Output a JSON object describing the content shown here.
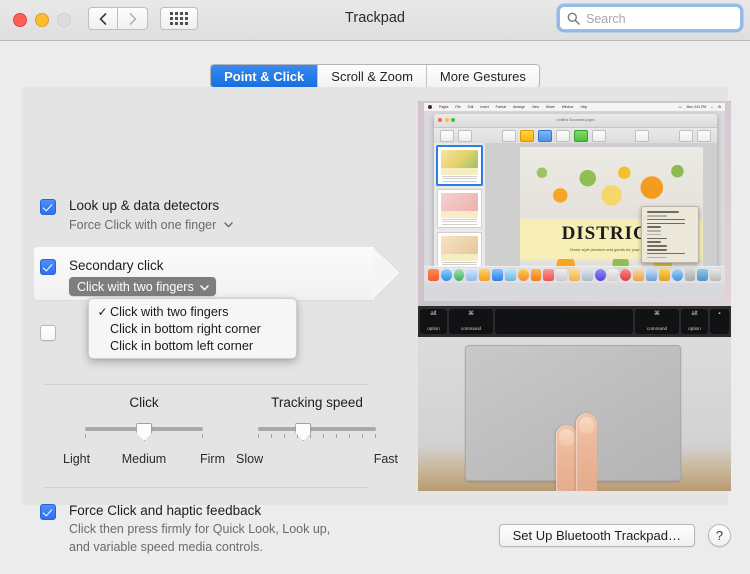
{
  "window": {
    "title": "Trackpad",
    "traffic_lights": [
      "close",
      "minimize",
      "zoom"
    ],
    "nav": {
      "back_icon": "chevron-left-icon",
      "forward_icon": "chevron-right-icon",
      "grid_icon": "show-all-grid-icon"
    }
  },
  "search": {
    "placeholder": "Search",
    "value": "",
    "icon": "search-icon"
  },
  "tabs": [
    {
      "label": "Point & Click",
      "selected": true
    },
    {
      "label": "Scroll & Zoom",
      "selected": false
    },
    {
      "label": "More Gestures",
      "selected": false
    }
  ],
  "settings": {
    "look_up": {
      "title": "Look up & data detectors",
      "option": "Force Click with one finger",
      "checked": true,
      "chevron_icon": "chevron-down-icon"
    },
    "secondary_click": {
      "title": "Secondary click",
      "option": "Click with two fingers",
      "checked": true,
      "highlighted": true,
      "chevron_icon": "chevron-down-icon",
      "menu_open": true,
      "menu_items": [
        {
          "label": "Click with two fingers",
          "checked": true
        },
        {
          "label": "Click in bottom right corner",
          "checked": false
        },
        {
          "label": "Click in bottom left corner",
          "checked": false
        }
      ]
    },
    "tap_to_click": {
      "checked": false
    },
    "click_slider": {
      "title": "Click",
      "left_label": "Light",
      "center_label": "Medium",
      "right_label": "Firm",
      "value_percent": 50,
      "ticks": 3
    },
    "tracking_slider": {
      "title": "Tracking speed",
      "left_label": "Slow",
      "right_label": "Fast",
      "value_percent": 38,
      "ticks": 10
    },
    "force_click": {
      "title": "Force Click and haptic feedback",
      "desc_line1": "Click then press firmly for Quick Look, Look up,",
      "desc_line2": "and variable speed media controls.",
      "checked": true
    }
  },
  "preview": {
    "app_title": "Untitled Document.pages",
    "document_headline": "DISTRICT",
    "document_subhead": "Home style produce and goods for your kitchen",
    "keys": [
      {
        "sym": "alt",
        "label": "option"
      },
      {
        "sym": "⌘",
        "label": "command"
      },
      {
        "sym": "",
        "label": ""
      },
      {
        "sym": "⌘",
        "label": "command"
      },
      {
        "sym": "alt",
        "label": "option"
      },
      {
        "sym": "▪",
        "label": ""
      }
    ]
  },
  "footer": {
    "bluetooth_button": "Set Up Bluetooth Trackpad…",
    "help_button": "?"
  }
}
